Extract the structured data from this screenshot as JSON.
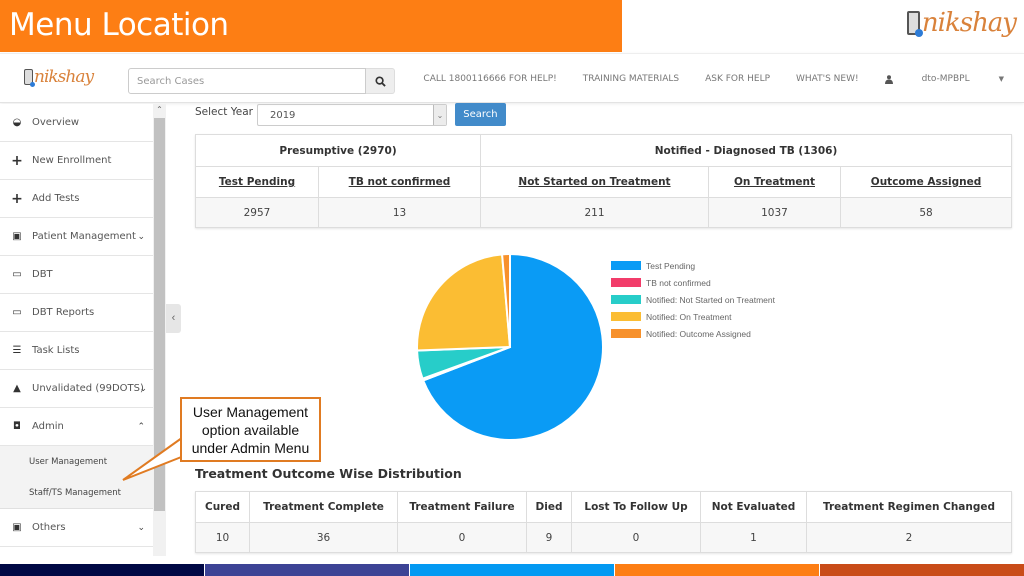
{
  "slide": {
    "title": "Menu Location",
    "brand": "nikshay"
  },
  "navbar": {
    "brand": "nikshay",
    "search_placeholder": "Search Cases",
    "links": [
      "CALL 1800116666 FOR HELP!",
      "TRAINING MATERIALS",
      "ASK FOR HELP",
      "WHAT'S NEW!"
    ],
    "user": "dto-MPBPL"
  },
  "sidebar": {
    "items": [
      {
        "label": "Overview",
        "icon": "dashboard-icon",
        "glyph": "◒"
      },
      {
        "label": "New Enrollment",
        "icon": "plus-icon",
        "glyph": "+"
      },
      {
        "label": "Add Tests",
        "icon": "plus-icon",
        "glyph": "+"
      },
      {
        "label": "Patient Management",
        "icon": "medkit-icon",
        "glyph": "▣",
        "chevron": "⌄"
      },
      {
        "label": "DBT",
        "icon": "money-icon",
        "glyph": "▭"
      },
      {
        "label": "DBT Reports",
        "icon": "money-icon",
        "glyph": "▭"
      },
      {
        "label": "Task Lists",
        "icon": "list-icon",
        "glyph": "☰"
      },
      {
        "label": "Unvalidated (99DOTS)",
        "icon": "warning-icon",
        "glyph": "▲",
        "chevron": "⌄"
      },
      {
        "label": "Admin",
        "icon": "user-icon",
        "glyph": "◘",
        "chevron": "⌃"
      }
    ],
    "admin_sub": [
      "User Management",
      "Staff/TS Management"
    ],
    "others": {
      "label": "Others",
      "glyph": "▣",
      "chevron": "⌄"
    }
  },
  "filter": {
    "label": "Select Year",
    "year": "2019",
    "button": "Search"
  },
  "summary": {
    "groups": [
      "Presumptive (2970)",
      "Notified - Diagnosed TB (1306)"
    ],
    "headers": [
      "Test Pending",
      "TB not confirmed",
      "Not Started on Treatment",
      "On Treatment",
      "Outcome Assigned"
    ],
    "values": [
      "2957",
      "13",
      "211",
      "1037",
      "58"
    ]
  },
  "chart_data": {
    "type": "pie",
    "title": "",
    "legend_position": "right",
    "labels": [
      "Test Pending",
      "TB not confirmed",
      "Notified: Not Started on Treatment",
      "Notified: On Treatment",
      "Notified: Outcome Assigned"
    ],
    "values": [
      2957,
      13,
      211,
      1037,
      58
    ],
    "colors": [
      "#0a9bf5",
      "#f23c6a",
      "#27cdc9",
      "#fbbd33",
      "#f7912c"
    ]
  },
  "callout": {
    "lines": [
      "User Management",
      "option available",
      "under Admin Menu"
    ]
  },
  "outcome": {
    "title": "Treatment Outcome Wise Distribution",
    "headers": [
      "Cured",
      "Treatment Complete",
      "Treatment Failure",
      "Died",
      "Lost To Follow Up",
      "Not Evaluated",
      "Treatment Regimen Changed"
    ],
    "values": [
      "10",
      "36",
      "0",
      "9",
      "0",
      "1",
      "2"
    ]
  },
  "theme": {
    "accent": "#fd7e14",
    "primary_button": "#428bca",
    "stripe": [
      "#000844",
      "#3c4395",
      "#0399f2",
      "#fd7e14",
      "#c94c18"
    ]
  }
}
